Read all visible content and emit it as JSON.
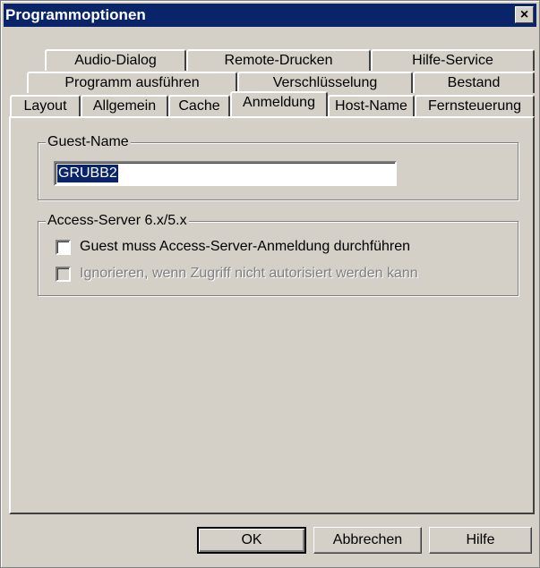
{
  "window": {
    "title": "Programmoptionen",
    "close_symbol": "×"
  },
  "tabs": {
    "row1": [
      "Audio-Dialog",
      "Remote-Drucken",
      "Hilfe-Service"
    ],
    "row2": [
      "Programm ausführen",
      "Verschlüsselung",
      "Bestand"
    ],
    "row3": [
      "Layout",
      "Allgemein",
      "Cache",
      "Anmeldung",
      "Host-Name",
      "Fernsteuerung"
    ],
    "active": "Anmeldung"
  },
  "guest_name_group": {
    "label": "Guest-Name",
    "value": "GRUBB2"
  },
  "access_server_group": {
    "label": "Access-Server 6.x/5.x",
    "checkbox1": {
      "label": "Guest muss Access-Server-Anmeldung durchführen",
      "checked": false,
      "enabled": true
    },
    "checkbox2": {
      "label": "Ignorieren, wenn Zugriff nicht autorisiert werden kann",
      "checked": false,
      "enabled": false
    }
  },
  "buttons": {
    "ok": "OK",
    "cancel": "Abbrechen",
    "help": "Hilfe"
  }
}
